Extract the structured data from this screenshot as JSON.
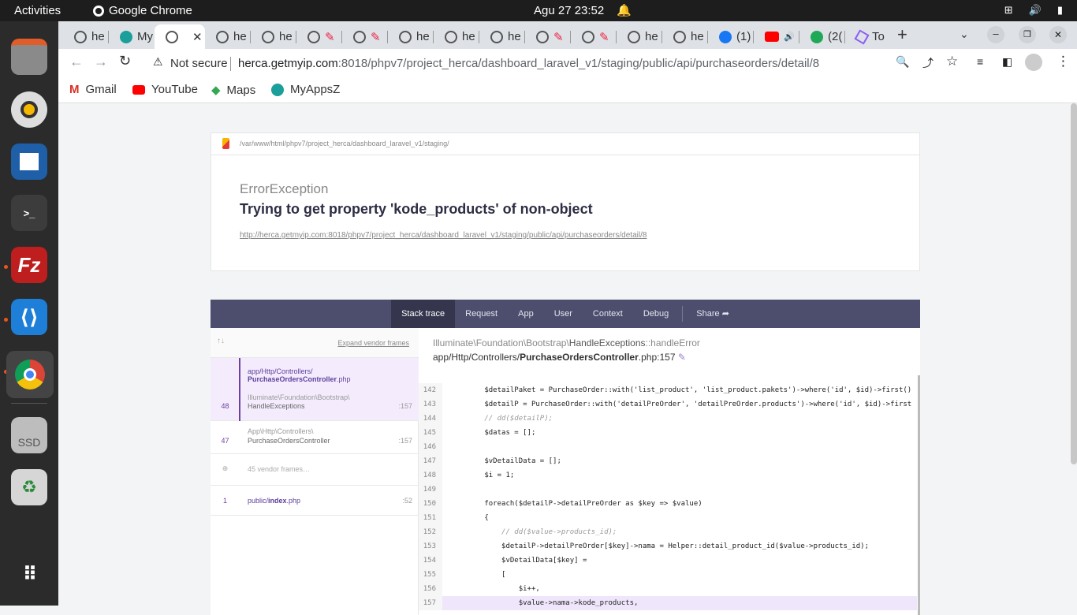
{
  "system_bar": {
    "activities": "Activities",
    "app_name": "Google Chrome",
    "clock": "Agu 27  23:52"
  },
  "dock": {
    "items": [
      {
        "name": "files-icon"
      },
      {
        "name": "rhythmbox-icon"
      },
      {
        "name": "writer-icon"
      },
      {
        "name": "terminal-icon"
      },
      {
        "name": "filezilla-icon"
      },
      {
        "name": "vscode-icon"
      },
      {
        "name": "chrome-icon"
      },
      {
        "name": "ssd-icon",
        "label": "SSD"
      },
      {
        "name": "trash-icon"
      },
      {
        "name": "apps-grid-icon"
      }
    ]
  },
  "tabs": {
    "items": [
      {
        "label": "he"
      },
      {
        "label": "My"
      },
      {
        "label": ""
      },
      {
        "label": "he"
      },
      {
        "label": "he"
      },
      {
        "label": ""
      },
      {
        "label": ""
      },
      {
        "label": "he"
      },
      {
        "label": "he"
      },
      {
        "label": "he"
      },
      {
        "label": ""
      },
      {
        "label": ""
      },
      {
        "label": "he"
      },
      {
        "label": "he"
      },
      {
        "label": "(1)"
      },
      {
        "label": ""
      },
      {
        "label": "(2("
      },
      {
        "label": "To"
      }
    ]
  },
  "address": {
    "security": "Not secure",
    "host": "herca.getmyip.com",
    "rest": ":8018/phpv7/project_herca/dashboard_laravel_v1/staging/public/api/purchaseorders/detail/8"
  },
  "bookmarks": [
    {
      "label": "Gmail"
    },
    {
      "label": "YouTube"
    },
    {
      "label": "Maps"
    },
    {
      "label": "MyAppsZ"
    }
  ],
  "error": {
    "path": "/var/www/html/phpv7/project_herca/dashboard_laravel_v1/staging/",
    "type": "ErrorException",
    "message": "Trying to get property 'kode_products' of non-object",
    "url": "http://herca.getmyip.com:8018/phpv7/project_herca/dashboard_laravel_v1/staging/public/api/purchaseorders/detail/8"
  },
  "nav": {
    "tabs": [
      "Stack trace",
      "Request",
      "App",
      "User",
      "Context",
      "Debug"
    ],
    "share": "Share"
  },
  "frames": {
    "expand": "Expand vendor frames",
    "f1_path": "app/Http/Controllers/",
    "f1_file": "PurchaseOrdersController",
    "f1_ext": ".php",
    "f1_sub": "Illuminate\\Foundation\\Bootstrap\\",
    "f1_class": "HandleExceptions",
    "f1_no": "48",
    "f1_line": ":157",
    "f2_path": "App\\Http\\Controllers\\",
    "f2_class": "PurchaseOrdersController",
    "f2_no": "47",
    "f2_line": ":157",
    "vendor": "45 vendor frames…",
    "f3_path": "public/",
    "f3_file": "index",
    "f3_ext": ".php",
    "f3_no": "1",
    "f3_line": ":52"
  },
  "exception": {
    "loc_prefix": "Illuminate\\Foundation\\Bootstrap\\",
    "loc_class": "HandleExceptions",
    "loc_method": "::handleError",
    "file_prefix": "app/Http/Controllers/",
    "file_name": "PurchaseOrdersController",
    "file_suffix": ".php:157"
  },
  "code": [
    {
      "no": "142",
      "src": "        $detailPaket = PurchaseOrder::with('list_product', 'list_product.pakets')->where('id', $id)->first()"
    },
    {
      "no": "143",
      "src": "        $detailP = PurchaseOrder::with('detailPreOrder', 'detailPreOrder.products')->where('id', $id)->first"
    },
    {
      "no": "144",
      "src": "        // dd($detailP);"
    },
    {
      "no": "145",
      "src": "        $datas = [];"
    },
    {
      "no": "146",
      "src": ""
    },
    {
      "no": "147",
      "src": "        $vDetailData = [];"
    },
    {
      "no": "148",
      "src": "        $i = 1;"
    },
    {
      "no": "149",
      "src": ""
    },
    {
      "no": "150",
      "src": "        foreach($detailP->detailPreOrder as $key => $value)"
    },
    {
      "no": "151",
      "src": "        {"
    },
    {
      "no": "152",
      "src": "            // dd($value->products_id);"
    },
    {
      "no": "153",
      "src": "            $detailP->detailPreOrder[$key]->nama = Helper::detail_product_id($value->products_id);"
    },
    {
      "no": "154",
      "src": "            $vDetailData[$key] ="
    },
    {
      "no": "155",
      "src": "            ["
    },
    {
      "no": "156",
      "src": "                $i++,"
    },
    {
      "no": "157",
      "src": "                $value->nama->kode_products,",
      "hl": true
    }
  ]
}
